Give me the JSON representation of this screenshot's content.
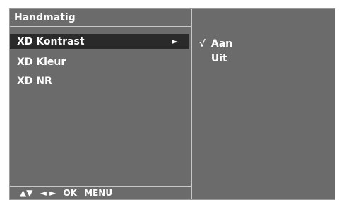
{
  "menu": {
    "title": "Handmatig",
    "items": [
      {
        "label": "XD Kontrast",
        "selected": true,
        "arrow": "►"
      },
      {
        "label": "XD Kleur"
      },
      {
        "label": "XD NR"
      }
    ],
    "footer": {
      "updown": "▲▼",
      "leftright": "◄ ►",
      "ok": "OK",
      "menu": "MENU"
    }
  },
  "submenu": {
    "options": [
      {
        "check": "√",
        "label": "Aan"
      },
      {
        "check": "",
        "label": "Uit"
      }
    ]
  },
  "colors": {
    "panel_bg": "#6b6b6b",
    "selected_bg": "#2a2a2a",
    "text": "#ffffff"
  }
}
